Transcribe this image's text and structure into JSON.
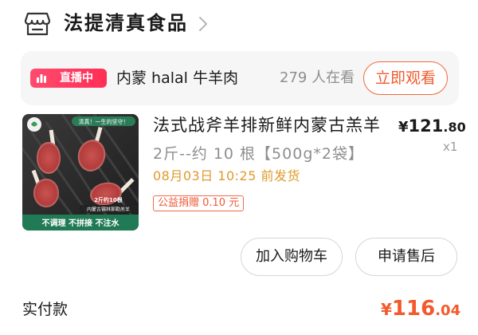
{
  "shop": {
    "name": "法提清真食品",
    "icon": "store-icon"
  },
  "live": {
    "badge": "直播中",
    "title": "内蒙 halal 牛羊肉",
    "viewers": "279 人在看",
    "watch_label": "立即观看",
    "accent": "#f25a2d"
  },
  "product": {
    "title": "法式战斧羊排新鲜内蒙古羔羊",
    "price_currency": "¥",
    "price_integer": "121",
    "price_cents": ".80",
    "quantity": "x1",
    "spec": "2斤--约 10 根【500g*2袋】",
    "ship_time": "08月03日 10:25 前发货",
    "charity_tag": "公益捐赠 0.10 元",
    "image_texts": {
      "top_banner": "清真！一生的坚守！",
      "weight": "2斤约10根",
      "origin": "内蒙古锡林郭勒羔羊",
      "bottom_bar": "不调理 不拼接 不注水"
    }
  },
  "actions": {
    "add_cart": "加入购物车",
    "after_sale": "申请售后"
  },
  "payment": {
    "label": "实付款",
    "currency": "¥",
    "integer": "116",
    "cents": ".04"
  }
}
